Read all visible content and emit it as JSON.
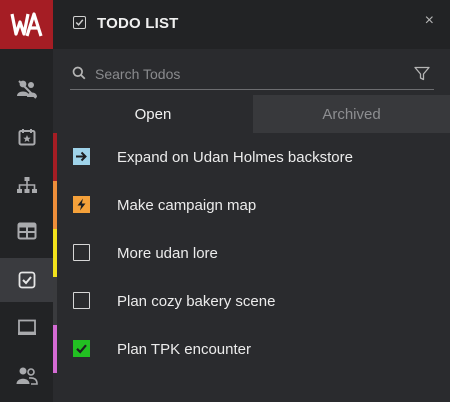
{
  "app": {
    "logo_text": "WA"
  },
  "header": {
    "title": "TODO LIST",
    "close_glyph": "×"
  },
  "search": {
    "placeholder": "Search Todos",
    "value": ""
  },
  "tabs": [
    {
      "label": "Open",
      "active": true
    },
    {
      "label": "Archived",
      "active": false
    }
  ],
  "rail_icons": [
    "characters-icon",
    "calendar-icon",
    "hierarchy-icon",
    "table-icon",
    "todo-check-icon",
    "easel-icon",
    "users-icon"
  ],
  "todos": [
    {
      "label": "Expand on Udan Holmes backstore",
      "status_icon": "arrow-right-icon",
      "bar_color": "#a51d24",
      "box_color": "#9fd3ea"
    },
    {
      "label": "Make campaign map",
      "status_icon": "lightning-icon",
      "bar_color": "#ee8e3a",
      "box_color": "#f5a13a"
    },
    {
      "label": "More udan lore",
      "status_icon": "empty-checkbox-icon",
      "bar_color": "#f2e21c",
      "box_color": ""
    },
    {
      "label": "Plan cozy bakery scene",
      "status_icon": "empty-checkbox-icon",
      "bar_color": "#3a3b3e",
      "box_color": ""
    },
    {
      "label": "Plan TPK encounter",
      "status_icon": "checked-icon",
      "bar_color": "#d46bd4",
      "box_color": "#22c022"
    }
  ],
  "colors": {
    "brand": "#a51d24",
    "panel": "#2a2b2e",
    "rail": "#222325",
    "archived_tab": "#38393c"
  }
}
